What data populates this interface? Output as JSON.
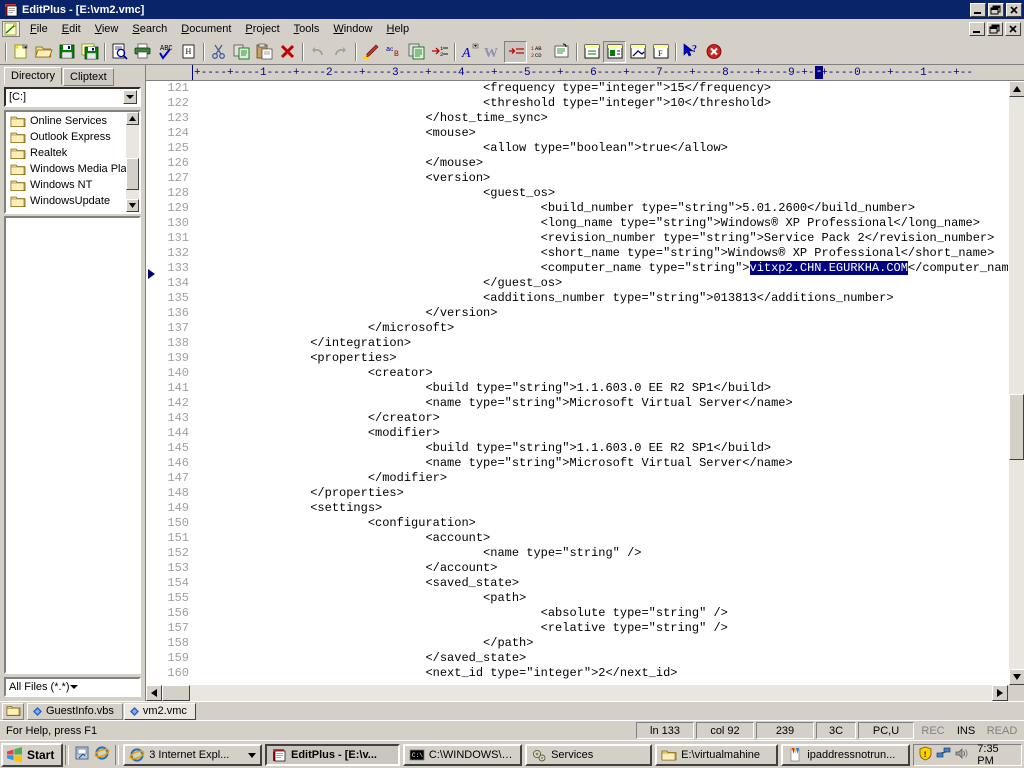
{
  "window": {
    "title": "EditPlus - [E:\\vm2.vmc]",
    "app_icon": "editplus-icon",
    "minimize": "_",
    "maximize": "□",
    "close": "✕"
  },
  "menubar": {
    "items": [
      {
        "label": "File",
        "accel": "F"
      },
      {
        "label": "Edit",
        "accel": "E"
      },
      {
        "label": "View",
        "accel": "V"
      },
      {
        "label": "Search",
        "accel": "S"
      },
      {
        "label": "Document",
        "accel": "D"
      },
      {
        "label": "Project",
        "accel": "P"
      },
      {
        "label": "Tools",
        "accel": "T"
      },
      {
        "label": "Window",
        "accel": "W"
      },
      {
        "label": "Help",
        "accel": "H"
      }
    ]
  },
  "toolbar": {
    "buttons": [
      {
        "name": "new-document-icon",
        "title": "New"
      },
      {
        "name": "open-folder-icon",
        "title": "Open"
      },
      {
        "name": "save-icon",
        "title": "Save"
      },
      {
        "name": "save-all-icon",
        "title": "Save All"
      },
      {
        "name": "print-preview-icon",
        "title": "Print Preview"
      },
      {
        "name": "print-icon",
        "title": "Print"
      },
      {
        "name": "spell-check-icon",
        "title": "Spell Check"
      },
      {
        "name": "html-toolbar-icon",
        "title": "HTML Toolbar"
      },
      {
        "name": "cut-icon",
        "title": "Cut"
      },
      {
        "name": "copy-icon",
        "title": "Copy"
      },
      {
        "name": "paste-icon",
        "title": "Paste"
      },
      {
        "name": "delete-icon",
        "title": "Delete"
      },
      {
        "name": "undo-icon",
        "title": "Undo"
      },
      {
        "name": "redo-icon",
        "title": "Redo"
      },
      {
        "name": "highlight-icon",
        "title": "Highlight"
      },
      {
        "name": "find-replace-icon",
        "title": "Find / Replace"
      },
      {
        "name": "duplicate-icon",
        "title": "Duplicate"
      },
      {
        "name": "indent-icon",
        "title": "Indent"
      },
      {
        "name": "font-icon",
        "title": "Font"
      },
      {
        "name": "word-wrap-icon",
        "title": "Word Wrap"
      },
      {
        "name": "line-numbers-icon",
        "title": "Line Numbers"
      },
      {
        "name": "sort-icon",
        "title": "Sort"
      },
      {
        "name": "browser-preview-icon",
        "title": "Browser Preview"
      },
      {
        "name": "document-selector-icon",
        "title": "Document Selector"
      },
      {
        "name": "directory-window-icon",
        "title": "Directory Window"
      },
      {
        "name": "ftp-upload-icon",
        "title": "FTP Upload"
      },
      {
        "name": "function-list-icon",
        "title": "Function List"
      },
      {
        "name": "help-pointer-icon",
        "title": "Context Help"
      },
      {
        "name": "close-window-icon",
        "title": "Close"
      }
    ]
  },
  "dock": {
    "tabs": [
      {
        "label": "Directory",
        "active": true
      },
      {
        "label": "Cliptext",
        "active": false
      }
    ],
    "drive_combo": {
      "value": "[C:]"
    },
    "tree_items": [
      "Online Services",
      "Outlook Express",
      "Realtek",
      "Windows Media Pla",
      "Windows NT",
      "WindowsUpdate"
    ],
    "filter_combo": {
      "value": "All Files (*.*)"
    }
  },
  "ruler": {
    "ticks": "+----+----1----+----2----+----3----+----4----+----5----+----6----+----7----+----8----+----9-+--+----0----+----1----+--",
    "caret_char": "-"
  },
  "editor": {
    "first_line": 121,
    "current_line": 133,
    "selection": "vitxp2.CHN.EGURKHA.COM",
    "lines": [
      {
        "n": 121,
        "text": "                                        <frequency type=\"integer\">15</frequency>"
      },
      {
        "n": 122,
        "text": "                                        <threshold type=\"integer\">10</threshold>"
      },
      {
        "n": 123,
        "text": "                                </host_time_sync>"
      },
      {
        "n": 124,
        "text": "                                <mouse>"
      },
      {
        "n": 125,
        "text": "                                        <allow type=\"boolean\">true</allow>"
      },
      {
        "n": 126,
        "text": "                                </mouse>"
      },
      {
        "n": 127,
        "text": "                                <version>"
      },
      {
        "n": 128,
        "text": "                                        <guest_os>"
      },
      {
        "n": 129,
        "text": "                                                <build_number type=\"string\">5.01.2600</build_number>"
      },
      {
        "n": 130,
        "text": "                                                <long_name type=\"string\">Windows® XP Professional</long_name>"
      },
      {
        "n": 131,
        "text": "                                                <revision_number type=\"string\">Service Pack 2</revision_number>"
      },
      {
        "n": 132,
        "text": "                                                <short_name type=\"string\">Windows® XP Professional</short_name>"
      },
      {
        "n": 133,
        "text": "                                                <computer_name type=\"string\">",
        "sel": "vitxp2.CHN.EGURKHA.COM",
        "after": "</computer_name>"
      },
      {
        "n": 134,
        "text": "                                        </guest_os>"
      },
      {
        "n": 135,
        "text": "                                        <additions_number type=\"string\">013813</additions_number>"
      },
      {
        "n": 136,
        "text": "                                </version>"
      },
      {
        "n": 137,
        "text": "                        </microsoft>"
      },
      {
        "n": 138,
        "text": "                </integration>"
      },
      {
        "n": 139,
        "text": "                <properties>"
      },
      {
        "n": 140,
        "text": "                        <creator>"
      },
      {
        "n": 141,
        "text": "                                <build type=\"string\">1.1.603.0 EE R2 SP1</build>"
      },
      {
        "n": 142,
        "text": "                                <name type=\"string\">Microsoft Virtual Server</name>"
      },
      {
        "n": 143,
        "text": "                        </creator>"
      },
      {
        "n": 144,
        "text": "                        <modifier>"
      },
      {
        "n": 145,
        "text": "                                <build type=\"string\">1.1.603.0 EE R2 SP1</build>"
      },
      {
        "n": 146,
        "text": "                                <name type=\"string\">Microsoft Virtual Server</name>"
      },
      {
        "n": 147,
        "text": "                        </modifier>"
      },
      {
        "n": 148,
        "text": "                </properties>"
      },
      {
        "n": 149,
        "text": "                <settings>"
      },
      {
        "n": 150,
        "text": "                        <configuration>"
      },
      {
        "n": 151,
        "text": "                                <account>"
      },
      {
        "n": 152,
        "text": "                                        <name type=\"string\" />"
      },
      {
        "n": 153,
        "text": "                                </account>"
      },
      {
        "n": 154,
        "text": "                                <saved_state>"
      },
      {
        "n": 155,
        "text": "                                        <path>"
      },
      {
        "n": 156,
        "text": "                                                <absolute type=\"string\" />"
      },
      {
        "n": 157,
        "text": "                                                <relative type=\"string\" />"
      },
      {
        "n": 158,
        "text": "                                        </path>"
      },
      {
        "n": 159,
        "text": "                                </saved_state>"
      },
      {
        "n": 160,
        "text": "                                <next_id type=\"integer\">2</next_id>"
      }
    ]
  },
  "doctabs": {
    "folder_icon": "folder-icon",
    "tabs": [
      {
        "label": "GuestInfo.vbs",
        "active": false
      },
      {
        "label": "vm2.vmc",
        "active": true
      }
    ]
  },
  "statusbar": {
    "help_text": "For Help, press F1",
    "cells": [
      {
        "label": "ln 133",
        "dim": false
      },
      {
        "label": "col 92",
        "dim": false
      },
      {
        "label": "239",
        "dim": false
      },
      {
        "label": "3C",
        "dim": false
      },
      {
        "label": "PC,U",
        "dim": false
      },
      {
        "label": "REC",
        "dim": true
      },
      {
        "label": "INS",
        "dim": false
      },
      {
        "label": "READ",
        "dim": true
      }
    ]
  },
  "taskbar": {
    "start_label": "Start",
    "quick_launch": [
      {
        "name": "show-desktop-icon"
      },
      {
        "name": "internet-explorer-icon"
      }
    ],
    "tasks": [
      {
        "label": "3 Internet Expl...",
        "icon": "internet-explorer-icon",
        "active": false,
        "group": true
      },
      {
        "label": "EditPlus - [E:\\v...",
        "icon": "editplus-icon",
        "active": true,
        "group": false
      },
      {
        "label": "C:\\WINDOWS\\sy...",
        "icon": "console-icon",
        "active": false,
        "group": false
      },
      {
        "label": "Services",
        "icon": "services-icon",
        "active": false,
        "group": false
      },
      {
        "label": "E:\\virtualmahine",
        "icon": "folder-icon",
        "active": false,
        "group": false
      },
      {
        "label": "ipaddressnotrun...",
        "icon": "notepad-icon",
        "active": false,
        "group": false
      }
    ],
    "tray_icons": [
      {
        "name": "security-shield-icon"
      },
      {
        "name": "network-icon"
      },
      {
        "name": "volume-icon"
      }
    ],
    "clock": "7:35 PM"
  },
  "colors": {
    "titlebar": "#0a246a",
    "face": "#d4d0c8",
    "selection": "#000080",
    "ruler_text": "#000080",
    "gutter_text": "#a0a0a0"
  }
}
